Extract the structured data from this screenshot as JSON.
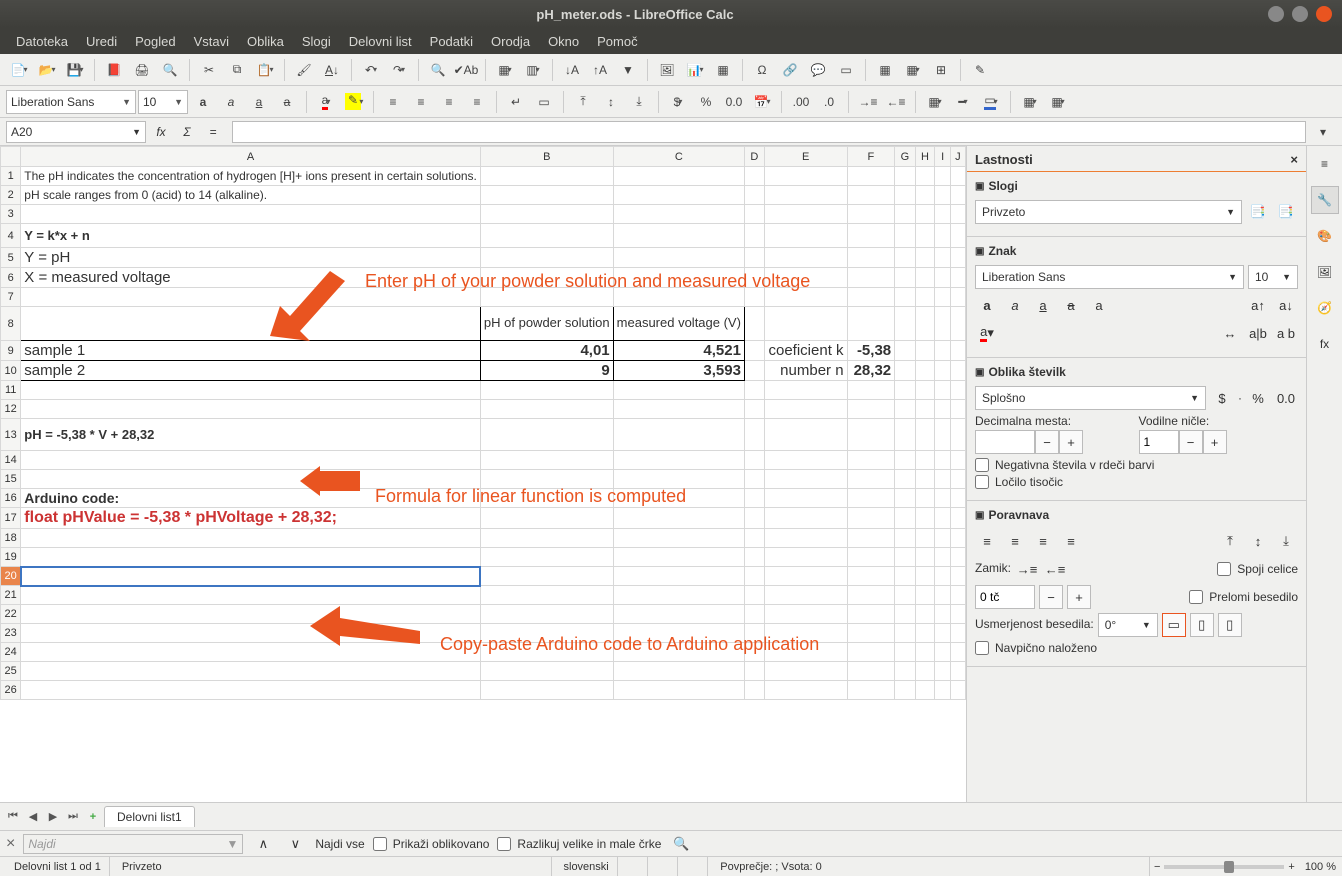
{
  "window": {
    "title": "pH_meter.ods - LibreOffice Calc"
  },
  "menus": [
    "Datoteka",
    "Uredi",
    "Pogled",
    "Vstavi",
    "Oblika",
    "Slogi",
    "Delovni list",
    "Podatki",
    "Orodja",
    "Okno",
    "Pomoč"
  ],
  "font": {
    "name": "Liberation Sans",
    "size": "10"
  },
  "cellref": "A20",
  "cells": {
    "A1": "The pH indicates the concentration of hydrogen [H]+ ions present in certain solutions.",
    "A2": "pH scale ranges from 0 (acid) to 14 (alkaline).",
    "A4": "Y = k*x + n",
    "A5": "Y = pH",
    "A6": "X = measured voltage",
    "B8": "pH of powder solution",
    "C8": "measured voltage (V)",
    "A9": "sample 1",
    "B9": "4,01",
    "C9": "4,521",
    "E9": "coeficient k",
    "F9": "-5,38",
    "A10": "sample 2",
    "B10": "9",
    "C10": "3,593",
    "E10": "number n",
    "F10": "28,32",
    "A13": "pH = -5,38 * V + 28,32",
    "A16": "Arduino code:",
    "A17": "float pHValue = -5,38 * pHVoltage + 28,32;"
  },
  "annotations": {
    "a1": "Enter pH of your powder solution and measured voltage",
    "a2": "Formula for linear function is computed",
    "a3": "Copy-paste Arduino code to Arduino application"
  },
  "sidepanel": {
    "title": "Lastnosti",
    "styles": {
      "header": "Slogi",
      "value": "Privzeto"
    },
    "char": {
      "header": "Znak",
      "font": "Liberation Sans",
      "size": "10"
    },
    "numfmt": {
      "header": "Oblika številk",
      "value": "Splošno",
      "decimal_label": "Decimalna mesta:",
      "leading_label": "Vodilne ničle:",
      "leading_value": "1",
      "percent_label": "0.0",
      "neg_red": "Negativna števila v rdeči barvi",
      "thousand": "Ločilo tisočic"
    },
    "align": {
      "header": "Poravnava",
      "indent_label": "Zamik:",
      "merge": "Spoji celice",
      "wrap": "Prelomi besedilo",
      "indent_value": "0 tč",
      "textdir_label": "Usmerjenost besedila:",
      "textdir_value": "0°",
      "vertical": "Navpično naloženo"
    }
  },
  "tabs": {
    "sheet1": "Delovni list1"
  },
  "findbar": {
    "placeholder": "Najdi",
    "all": "Najdi vse",
    "formatted": "Prikaži oblikovano",
    "matchcase": "Razlikuj velike in male črke"
  },
  "status": {
    "sheet": "Delovni list 1 od 1",
    "style": "Privzeto",
    "lang": "slovenski",
    "stats": "Povprečje: ; Vsota: 0",
    "zoom": "100 %"
  }
}
